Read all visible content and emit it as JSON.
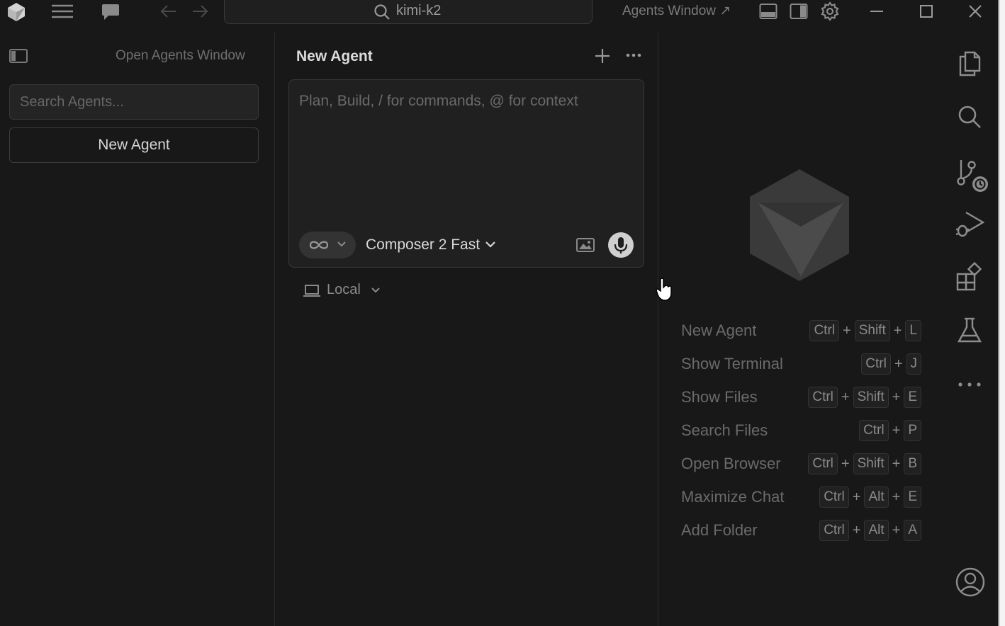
{
  "titlebar": {
    "search_text": "kimi-k2",
    "agents_window_label": "Agents Window ↗"
  },
  "sidebar": {
    "open_agents_window": "Open Agents Window",
    "search_placeholder": "Search Agents...",
    "new_agent_button": "New Agent"
  },
  "agent_panel": {
    "title": "New Agent",
    "composer_placeholder": "Plan, Build, / for commands, @ for context",
    "model": "Composer 2 Fast",
    "location": "Local"
  },
  "shortcuts": [
    {
      "label": "New Agent",
      "keys": [
        "Ctrl",
        "Shift",
        "L"
      ]
    },
    {
      "label": "Show Terminal",
      "keys": [
        "Ctrl",
        "J"
      ]
    },
    {
      "label": "Show Files",
      "keys": [
        "Ctrl",
        "Shift",
        "E"
      ]
    },
    {
      "label": "Search Files",
      "keys": [
        "Ctrl",
        "P"
      ]
    },
    {
      "label": "Open Browser",
      "keys": [
        "Ctrl",
        "Shift",
        "B"
      ]
    },
    {
      "label": "Maximize Chat",
      "keys": [
        "Ctrl",
        "Alt",
        "E"
      ]
    },
    {
      "label": "Add Folder",
      "keys": [
        "Ctrl",
        "Alt",
        "A"
      ]
    }
  ],
  "icons": {
    "titlebar": [
      "app-logo-icon",
      "menu-icon",
      "chat-icon",
      "back-arrow-icon",
      "forward-arrow-icon",
      "search-icon",
      "toggle-panel-icon",
      "toggle-secondary-sidebar-icon",
      "settings-gear-icon",
      "minimize-icon",
      "maximize-icon",
      "close-icon"
    ],
    "activity_bar": [
      "files-icon",
      "search-icon",
      "source-control-icon",
      "run-debug-icon",
      "extensions-icon",
      "testing-flask-icon",
      "more-icon",
      "account-icon"
    ]
  },
  "colors": {
    "background": "#181818",
    "panel": "#202020",
    "border": "#383838",
    "text_primary": "#d8d8d8",
    "text_muted": "#6a6a6a"
  }
}
